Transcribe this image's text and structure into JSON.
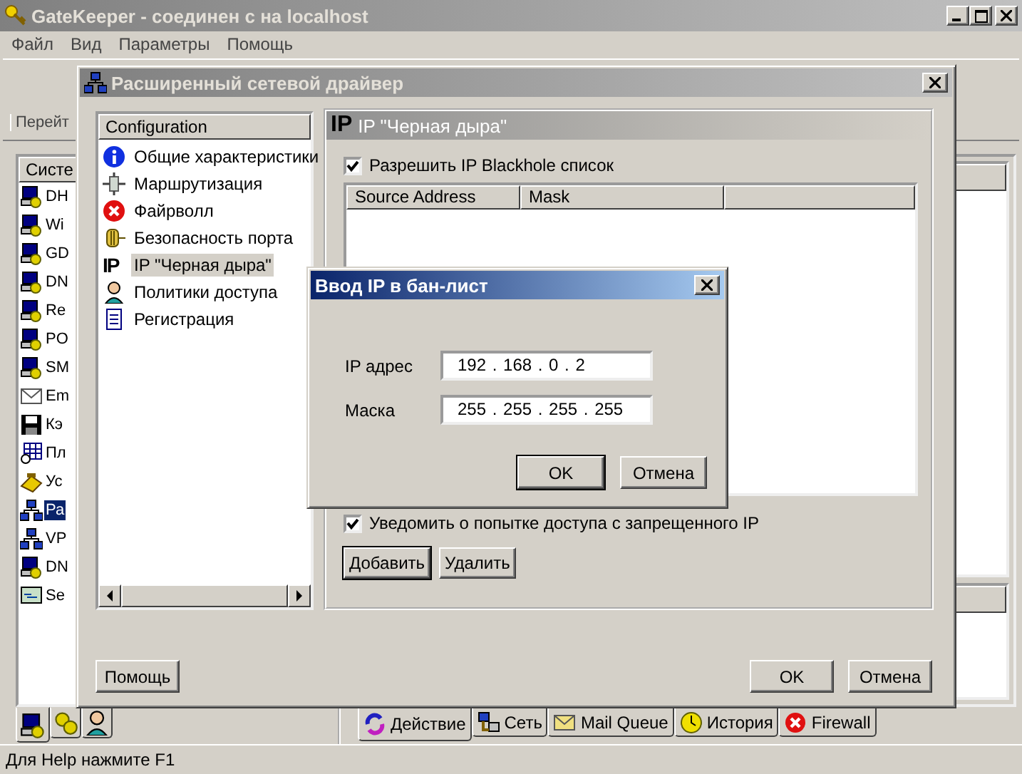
{
  "main_window": {
    "title": "GateKeeper - соединен с на localhost",
    "menu": [
      "Файл",
      "Вид",
      "Параметры",
      "Помощь"
    ],
    "toolbar_button": "Перейт",
    "services_list": {
      "header": "Систе",
      "items": [
        {
          "label": "DH",
          "selected": false
        },
        {
          "label": "Wi",
          "selected": false
        },
        {
          "label": "GD",
          "selected": false
        },
        {
          "label": "DN",
          "selected": false
        },
        {
          "label": "Re",
          "selected": false
        },
        {
          "label": "PO",
          "selected": false
        },
        {
          "label": "SM",
          "selected": false
        },
        {
          "label": "Em",
          "selected": false
        },
        {
          "label": "Кэ",
          "selected": false
        },
        {
          "label": "Пл",
          "selected": false
        },
        {
          "label": "Ус",
          "selected": false
        },
        {
          "label": "Ра",
          "selected": true
        },
        {
          "label": "VP",
          "selected": false
        },
        {
          "label": "DN",
          "selected": false
        },
        {
          "label": "Se",
          "selected": false
        }
      ]
    },
    "view_tabs": [
      {
        "selected": true
      },
      {
        "selected": false
      },
      {
        "selected": false
      }
    ],
    "bottom_tabs": [
      {
        "label": "Действие",
        "selected": true
      },
      {
        "label": "Сеть",
        "selected": false
      },
      {
        "label": "Mail Queue",
        "selected": false
      },
      {
        "label": "История",
        "selected": false
      },
      {
        "label": "Firewall",
        "selected": false
      }
    ],
    "status_bar": "Для Help нажмите F1"
  },
  "driver_dialog": {
    "title": "Расширенный сетевой драйвер",
    "tree_header": "Configuration",
    "tree_items": [
      {
        "label": "Общие характеристики",
        "selected": false
      },
      {
        "label": "Маршрутизация",
        "selected": false
      },
      {
        "label": "Файрволл",
        "selected": false
      },
      {
        "label": "Безопасность порта",
        "selected": false
      },
      {
        "label": "IP \"Черная дыра\"",
        "selected": true,
        "icon_text": "IP"
      },
      {
        "label": "Политики доступа",
        "selected": false
      },
      {
        "label": "Регистрация",
        "selected": false
      }
    ],
    "panel_badge": "IP",
    "panel_title": "IP \"Черная дыра\"",
    "enable_list": {
      "label": "Разрешить IP Blackhole список",
      "checked": true
    },
    "columns": [
      "Source Address",
      "Mask"
    ],
    "notify": {
      "label": "Уведомить о попытке доступа с запрещенного IP",
      "checked": true
    },
    "list_buttons": [
      "Добавить",
      "Удалить"
    ],
    "help_button": "Помощь",
    "buttons": [
      "OK",
      "Отмена"
    ]
  },
  "ban_dialog": {
    "title": "Ввод IP в бан-лист",
    "fields": [
      {
        "label": "IP адрес",
        "value": "192 . 168 . 0 . 2"
      },
      {
        "label": "Маска",
        "value": "255 . 255 . 255 . 255"
      }
    ],
    "buttons": [
      "OK",
      "Отмена"
    ]
  }
}
